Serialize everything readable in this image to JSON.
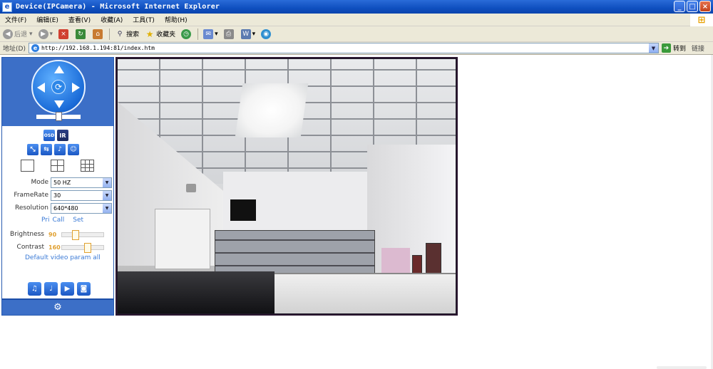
{
  "window": {
    "title": "Device(IPCamera) - Microsoft Internet Explorer",
    "minimize": "_",
    "maximize": "□",
    "close": "×"
  },
  "menu": [
    "文件(F)",
    "编辑(E)",
    "查看(V)",
    "收藏(A)",
    "工具(T)",
    "帮助(H)"
  ],
  "toolbar": {
    "back": "后退",
    "search": "搜索",
    "favorites": "收藏夹"
  },
  "address": {
    "label": "地址(D)",
    "url": "http://192.168.1.194:81/index.htm",
    "go": "转到",
    "links": "链接"
  },
  "panel": {
    "osd_label": "OSD",
    "ir_label": "IR",
    "mode_label": "Mode",
    "mode_value": "50 HZ",
    "framerate_label": "FrameRate",
    "framerate_value": "30",
    "resolution_label": "Resolution",
    "resolution_value": "640*480",
    "pri_label": "Pri",
    "call_label": "Call",
    "set_label": "Set",
    "brightness_label": "Brightness",
    "brightness_value": "90",
    "contrast_label": "Contrast",
    "contrast_value": "160",
    "default_link": "Default video param all"
  },
  "colors": {
    "panel_blue": "#3c6fc7",
    "accent_orange": "#e0a030",
    "link_blue": "#3a7ad6"
  }
}
